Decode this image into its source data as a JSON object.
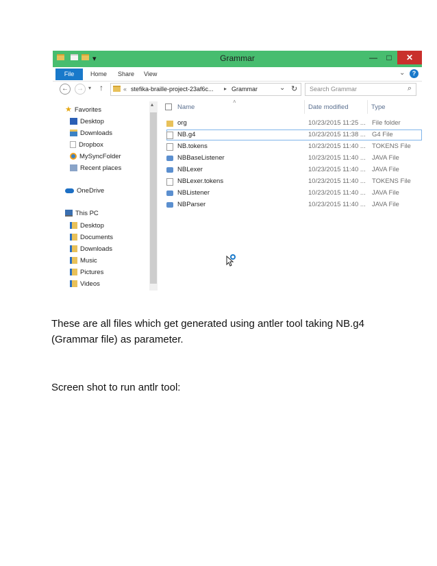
{
  "window": {
    "title": "Grammar",
    "colors": {
      "titlebar": "#47bd6f",
      "accent": "#1979ca",
      "close": "#c9302c"
    },
    "qat_arrow": "▾",
    "controls": {
      "minimize": "—",
      "maximize": "□",
      "close": "✕"
    }
  },
  "ribbon": {
    "tabs": [
      "File",
      "Home",
      "Share",
      "View"
    ],
    "expand": "⌄",
    "help": "?"
  },
  "addressbar": {
    "back": "←",
    "forward": "→",
    "recent": "▾",
    "up": "↑",
    "overflow": "«",
    "segments": [
      "stefika-braille-project-23af6c...",
      "Grammar"
    ],
    "separator": "▸",
    "dropdown": "⌄",
    "refresh": "↻",
    "search_placeholder": "Search Grammar",
    "search_icon": "⌕"
  },
  "nav_pane": {
    "favorites": {
      "label": "Favorites",
      "items": [
        "Desktop",
        "Downloads",
        "Dropbox",
        "MySyncFolder",
        "Recent places"
      ]
    },
    "onedrive": "OneDrive",
    "this_pc": {
      "label": "This PC",
      "items": [
        "Desktop",
        "Documents",
        "Downloads",
        "Music",
        "Pictures",
        "Videos"
      ]
    },
    "scroll_up": "▴"
  },
  "file_list": {
    "columns": {
      "name": "Name",
      "date": "Date modified",
      "type": "Type"
    },
    "sort_indicator": "˄",
    "rows": [
      {
        "name": "org",
        "date": "10/23/2015 11:25 ...",
        "type": "File folder",
        "icon": "folder"
      },
      {
        "name": "NB.g4",
        "date": "10/23/2015 11:38 ...",
        "type": "G4 File",
        "icon": "file"
      },
      {
        "name": "NB.tokens",
        "date": "10/23/2015 11:40 ...",
        "type": "TOKENS File",
        "icon": "file"
      },
      {
        "name": "NBBaseListener",
        "date": "10/23/2015 11:40 ...",
        "type": "JAVA File",
        "icon": "java"
      },
      {
        "name": "NBLexer",
        "date": "10/23/2015 11:40 ...",
        "type": "JAVA File",
        "icon": "java"
      },
      {
        "name": "NBLexer.tokens",
        "date": "10/23/2015 11:40 ...",
        "type": "TOKENS File",
        "icon": "file"
      },
      {
        "name": "NBListener",
        "date": "10/23/2015 11:40 ...",
        "type": "JAVA File",
        "icon": "java"
      },
      {
        "name": "NBParser",
        "date": "10/23/2015 11:40 ...",
        "type": "JAVA File",
        "icon": "java"
      }
    ]
  },
  "document": {
    "paragraph1_line1": "These are all files which get generated using antler tool taking NB.g4",
    "paragraph1_line2": "(Grammar file) as parameter.",
    "paragraph2": "Screen shot to run antlr tool:"
  }
}
